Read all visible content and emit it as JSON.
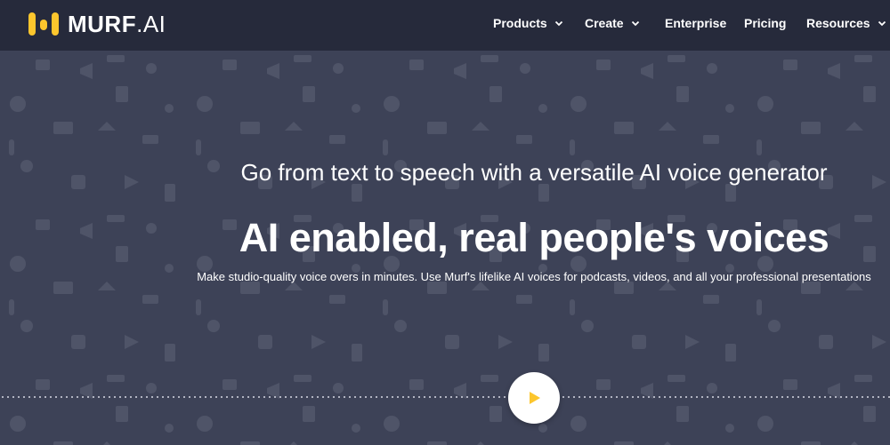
{
  "brand": {
    "name_bold": "MURF",
    "name_dot": ".",
    "name_light": "AI",
    "accent_color": "#fcc62d"
  },
  "nav": {
    "items": [
      {
        "label": "Products",
        "has_dropdown": true
      },
      {
        "label": "Create",
        "has_dropdown": true
      },
      {
        "label": "Enterprise",
        "has_dropdown": false
      },
      {
        "label": "Pricing",
        "has_dropdown": false
      },
      {
        "label": "Resources",
        "has_dropdown": true
      }
    ]
  },
  "hero": {
    "subtitle": "Go from text to speech with a versatile AI voice generator",
    "headline": "AI enabled, real people's voices",
    "description": "Make studio-quality voice overs in minutes. Use Murf's lifelike AI voices for podcasts, videos, and all your professional presentations",
    "background_color": "#3d4257",
    "play_icon": "play-icon"
  }
}
